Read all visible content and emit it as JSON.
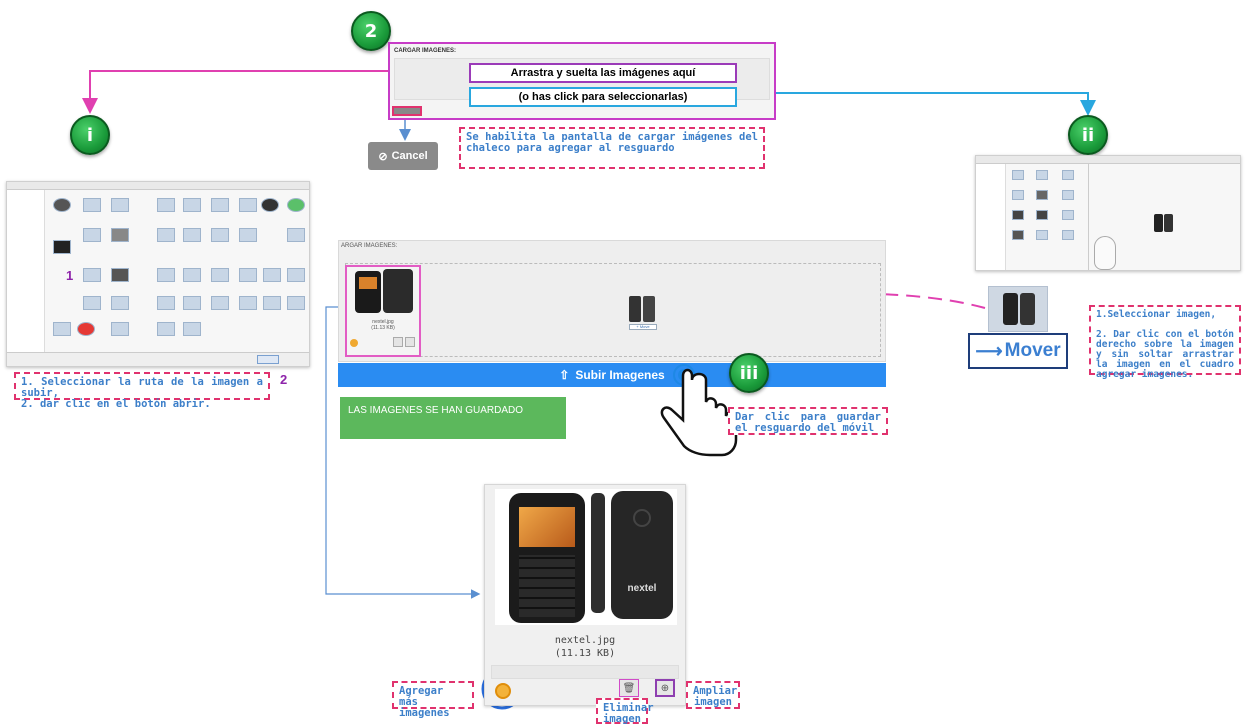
{
  "upload_top": {
    "label": "CARGAR IMAGENES:",
    "drag_text": "Arrastra y suelta las imágenes aquí",
    "click_text": "(o has click para seleccionarlas)"
  },
  "cancel_label": "Cancel",
  "steps": {
    "s2": "2",
    "si": "i",
    "sii": "ii",
    "siii": "iii"
  },
  "callouts": {
    "enable": "Se habilita la pantalla de cargar imágenes del chaleco para agregar al resguardo",
    "route": "1. Seleccionar la ruta de la imagen a subir,\n2. dar clic en el botón abrir.",
    "drag": "1.Seleccionar imagen,\n\n2. Dar clic con el botón derecho sobre la imagen y sin soltar arrastrar la imagen en el cuadro agregar imagenes.",
    "save": "Dar clic para guardar el resguardo del móvil",
    "add_more": "Agregar más imagenes",
    "delete": "Eliminar imagen",
    "zoom": "Ampliar imagen"
  },
  "explorer_marks": {
    "one": "1",
    "two": "2"
  },
  "main_panel": {
    "label": "ARGAR IMAGENES:",
    "small_name": "nextel.jpg",
    "small_size": "(11.13 KB)",
    "move_tag": "+ Move"
  },
  "subir_label": "Subir Imagenes",
  "saved_msg": "LAS IMAGENES SE HAN GUARDADO",
  "big_card": {
    "filename": "nextel.jpg",
    "filesize": "(11.13 KB)",
    "brand": "nextel"
  },
  "mover_label": "Mover",
  "colors": {
    "magenta": "#e0326e",
    "purple": "#c73cc7",
    "cyan": "#29a7df",
    "blue": "#2a8cf2",
    "green": "#5cb85c"
  }
}
